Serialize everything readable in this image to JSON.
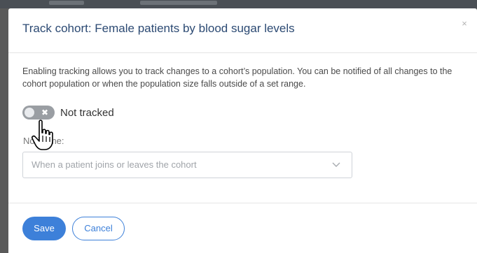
{
  "modal": {
    "title": "Track cohort: Female patients by blood sugar levels",
    "close_glyph": "×",
    "description": "Enabling tracking allows you to track changes to a cohort’s population. You can be notified of all changes to the cohort population or when the population size falls outside of a set range.",
    "toggle": {
      "state": "off",
      "label": "Not tracked",
      "icon": "x-icon"
    },
    "notify": {
      "label": "Notify me:",
      "value": "When a patient joins or leaves the cohort",
      "icon": "chevron-down-icon"
    },
    "footer": {
      "save_label": "Save",
      "cancel_label": "Cancel"
    }
  },
  "colors": {
    "accent": "#3d80d9",
    "title": "#2c4a73",
    "toggle_off": "#9a9ea3"
  },
  "cursor": {
    "icon": "hand-pointer-icon"
  }
}
